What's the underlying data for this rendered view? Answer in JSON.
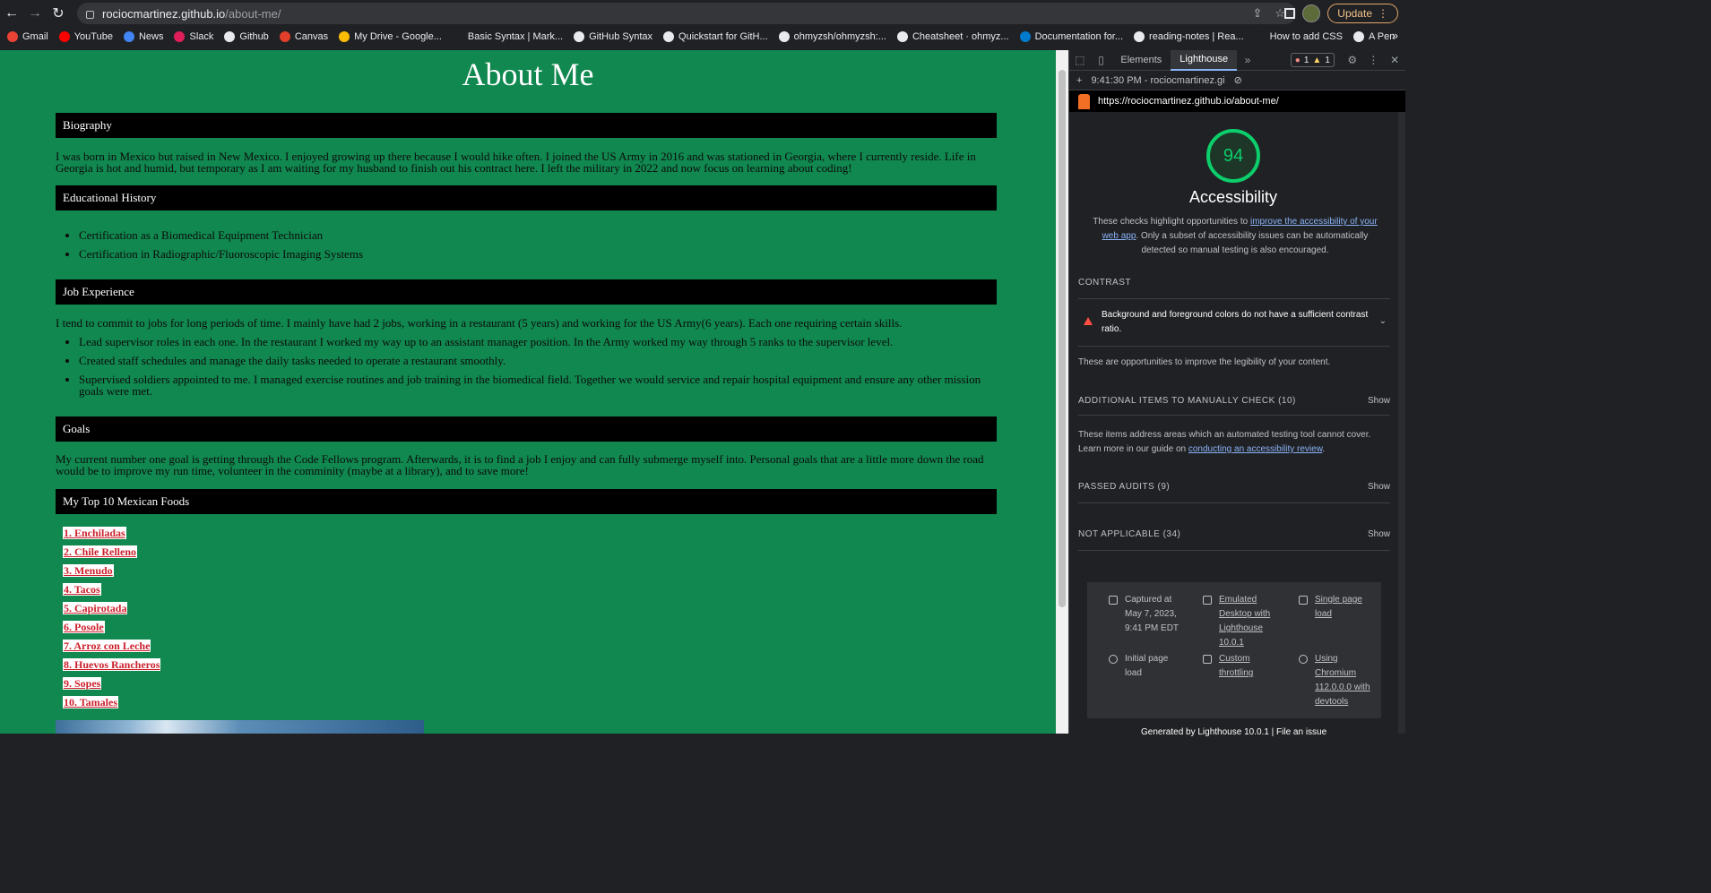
{
  "browser": {
    "url_host": "rociocmartinez.github.io",
    "url_path": "/about-me/",
    "update_label": "Update",
    "bookmarks": [
      {
        "label": "Gmail",
        "color": "#ea4335"
      },
      {
        "label": "YouTube",
        "color": "#ff0000"
      },
      {
        "label": "News",
        "color": "#4285f4"
      },
      {
        "label": "Slack",
        "color": "#e01e5a"
      },
      {
        "label": "Github",
        "color": "#e8eaed"
      },
      {
        "label": "Canvas",
        "color": "#e13f2b"
      },
      {
        "label": "My Drive - Google...",
        "color": "#fbbc04"
      },
      {
        "label": "Basic Syntax | Mark...",
        "color": "#202124"
      },
      {
        "label": "GitHub Syntax",
        "color": "#e8eaed"
      },
      {
        "label": "Quickstart for GitH...",
        "color": "#e8eaed"
      },
      {
        "label": "ohmyzsh/ohmyzsh:...",
        "color": "#e8eaed"
      },
      {
        "label": "Cheatsheet · ohmyz...",
        "color": "#e8eaed"
      },
      {
        "label": "Documentation for...",
        "color": "#007acc"
      },
      {
        "label": "reading-notes | Rea...",
        "color": "#e8eaed"
      },
      {
        "label": "How to add CSS",
        "color": "#202124"
      },
      {
        "label": "A Pen",
        "color": "#e8eaed"
      }
    ]
  },
  "page": {
    "title": "About Me",
    "biography_heading": "Biography",
    "biography_text": "I was born in Mexico but raised in New Mexico. I enjoyed growing up there because I would hike often. I joined the US Army in 2016 and was stationed in Georgia, where I currently reside. Life in Georgia is hot and humid, but temporary as I am waiting for my husband to finish out his contract here. I left the military in 2022 and now focus on learning about coding!",
    "education_heading": "Educational History",
    "education_items": [
      "Certification as a Biomedical Equipment Technician",
      "Certification in Radiographic/Fluoroscopic Imaging Systems"
    ],
    "job_heading": "Job Experience",
    "job_intro": "I tend to commit to jobs for long periods of time. I mainly have had 2 jobs, working in a restaurant (5 years) and working for the US Army(6 years). Each one requiring certain skills.",
    "job_items": [
      "Lead supervisor roles in each one. In the restaurant I worked my way up to an assistant manager position. In the Army worked my way through 5 ranks to the supervisor level.",
      "Created staff schedules and manage the daily tasks needed to operate a restaurant smoothly.",
      "Supervised soldiers appointed to me. I managed exercise routines and job training in the biomedical field. Together we would service and repair hospital equipment and ensure any other mission goals were met."
    ],
    "goals_heading": "Goals",
    "goals_text": "My current number one goal is getting through the Code Fellows program. Afterwards, it is to find a job I enjoy and can fully submerge myself into. Personal goals that are a little more down the road would be to improve my run time, volunteer in the comminity (maybe at a library), and to save more!",
    "foods_heading": "My Top 10 Mexican Foods",
    "foods": [
      "1. Enchiladas",
      "2. Chile Relleno",
      "3. Menudo",
      "4. Tacos",
      "5. Capirotada",
      "6. Posole",
      "7. Arroz con Leche",
      "8. Huevos Rancheros",
      "9. Sopes",
      "10. Tamales"
    ]
  },
  "devtools": {
    "tab_elements": "Elements",
    "tab_lighthouse": "Lighthouse",
    "error_count": "1",
    "warning_count": "1",
    "report_time": "9:41:30 PM - rociocmartinez.gi",
    "report_url": "https://rociocmartinez.github.io/about-me/",
    "score": "94",
    "category": "Accessibility",
    "desc_pre": "These checks highlight opportunities to ",
    "desc_link": "improve the accessibility of your web app",
    "desc_post": ". Only a subset of accessibility issues can be automatically detected so manual testing is also encouraged.",
    "contrast_heading": "CONTRAST",
    "contrast_audit": "Background and foreground colors do not have a sufficient contrast ratio.",
    "contrast_note": "These are opportunities to improve the legibility of your content.",
    "manual_heading": "ADDITIONAL ITEMS TO MANUALLY CHECK (10)",
    "manual_text_pre": "These items address areas which an automated testing tool cannot cover. Learn more in our guide on ",
    "manual_link": "conducting an accessibility review",
    "manual_text_post": ".",
    "passed_heading": "PASSED AUDITS (9)",
    "na_heading": "NOT APPLICABLE (34)",
    "show_label": "Show",
    "runtime": {
      "captured": "Captured at May 7, 2023, 9:41 PM EDT",
      "emulated": "Emulated Desktop with Lighthouse 10.0.1",
      "single": "Single page load",
      "initial": "Initial page load",
      "throttling": "Custom throttling",
      "chromium": "Using Chromium 112.0.0.0 with devtools"
    },
    "footer": "Generated by Lighthouse 10.0.1 | File an issue"
  },
  "colors": {
    "page_bg": "#10884f",
    "score_green": "#0cce6b",
    "fail_red": "#ff4e42"
  }
}
